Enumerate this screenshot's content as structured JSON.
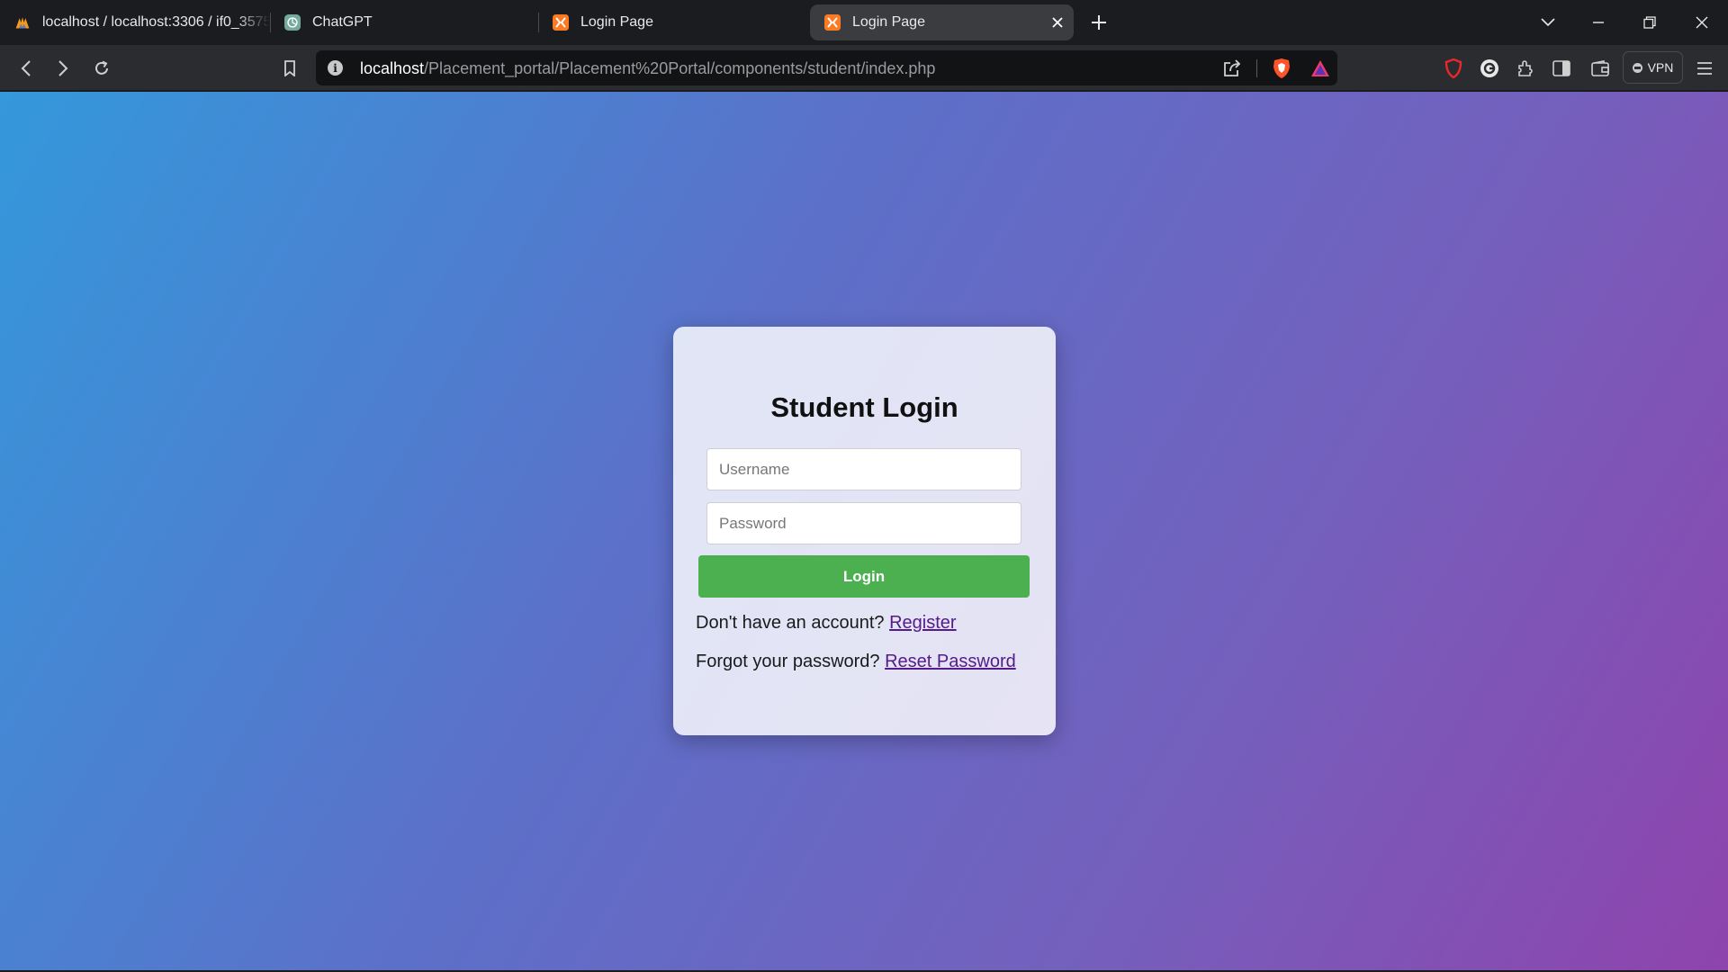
{
  "browser": {
    "tabs": [
      {
        "title": "localhost / localhost:3306 / if0_3575",
        "active": false
      },
      {
        "title": "ChatGPT",
        "active": false
      },
      {
        "title": "Login Page",
        "active": false
      },
      {
        "title": "Login Page",
        "active": true
      }
    ],
    "address": {
      "host": "localhost",
      "path": "/Placement_portal/Placement%20Portal/components/student/index.php"
    },
    "vpn_label": "VPN"
  },
  "login": {
    "title": "Student Login",
    "username_placeholder": "Username",
    "password_placeholder": "Password",
    "button_label": "Login",
    "register_prompt": "Don't have an account?",
    "register_link": "Register",
    "reset_prompt": "Forgot your password?",
    "reset_link": "Reset Password"
  },
  "colors": {
    "accent_button": "#4caf50",
    "link": "#551a8b",
    "gradient_start": "#3498db",
    "gradient_end": "#8e44ad"
  }
}
